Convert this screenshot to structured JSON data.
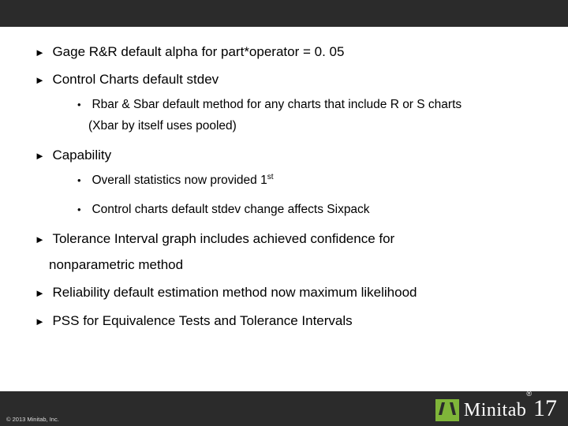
{
  "bullets": {
    "b0": "Gage R&R default alpha for part*operator = 0. 05",
    "b1": "Control Charts default stdev",
    "b1_sub": {
      "s0_line1": "Rbar & Sbar default method for any charts that include R or S charts",
      "s0_line2": "(Xbar by itself uses pooled)"
    },
    "b2": "Capability",
    "b2_sub": {
      "s0_prefix": "Overall statistics now provided 1",
      "s0_suffix": "st",
      "s1": "Control charts default stdev change affects Sixpack"
    },
    "b3_line1": "Tolerance Interval graph includes achieved confidence for",
    "b3_line2": "nonparametric method",
    "b4": "Reliability default estimation method now maximum likelihood",
    "b5": "PSS for Equivalence Tests and Tolerance Intervals"
  },
  "footer": {
    "copyright": "© 2013 Minitab, Inc.",
    "brand": "Minitab",
    "version": "17"
  }
}
